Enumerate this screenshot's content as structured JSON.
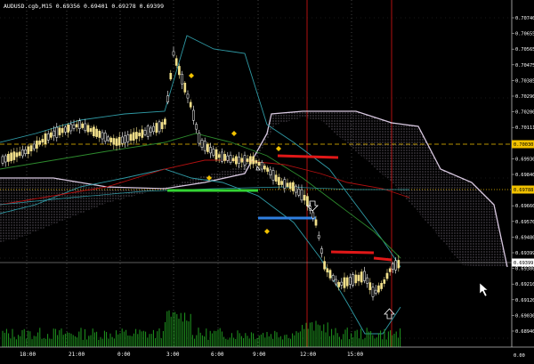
{
  "window": {
    "symbol_line": "AUDUSD.cgb,M15  0.69356 0.69401 0.69278 0.69399"
  },
  "price_axis": {
    "labels": [
      "0.70740",
      "0.70655",
      "0.70565",
      "0.70475",
      "0.70385",
      "0.70290",
      "0.70200",
      "0.70111",
      "0.70030",
      "0.69930",
      "0.69840",
      "0.69750",
      "0.69660",
      "0.69570",
      "0.69480",
      "0.69399",
      "0.69300",
      "0.69210",
      "0.69120",
      "0.69030",
      "0.68940"
    ],
    "badges": [
      {
        "text": "0.70030",
        "color": "#f2c200",
        "text_color": "#000000"
      },
      {
        "text": "0.69788",
        "color": "#f2c200",
        "text_color": "#000000"
      },
      {
        "text": "0.69399",
        "color": "#ffffff",
        "text_color": "#000000"
      }
    ],
    "bottom_label": "0.00"
  },
  "time_axis": {
    "labels": [
      "18:00",
      "21:00",
      "0:00",
      "3:00",
      "6:00",
      "9:00",
      "12:00",
      "15:00"
    ]
  },
  "colors": {
    "background": "#000000",
    "bull": "#ffffff",
    "bear": "#f2e08a",
    "cloud": "#d8c8e0",
    "bollinger": "#2f9aa5",
    "ma_red": "#b01010",
    "ma_green": "#2d8a2d",
    "level_green": "#34d334",
    "level_blue": "#2f7fe0",
    "level_red": "#e01818",
    "volume": "#1f9a1f",
    "vline": "#b01010"
  }
}
